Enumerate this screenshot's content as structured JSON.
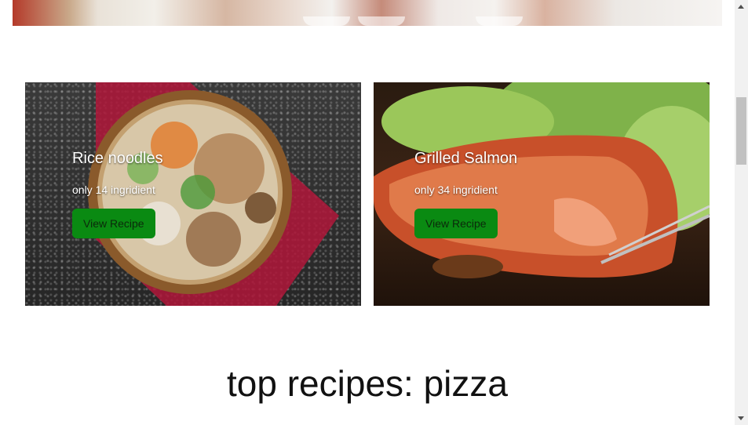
{
  "cards": [
    {
      "title": "Rice noodles",
      "subtitle": "only 14 ingridient",
      "button": "View Recipe"
    },
    {
      "title": "Grilled Salmon",
      "subtitle": "only 34 ingridient",
      "button": "View Recipe"
    }
  ],
  "section": {
    "heading": "top recipes: pizza"
  },
  "colors": {
    "button": "#0a8a12",
    "background": "#ffffff"
  }
}
